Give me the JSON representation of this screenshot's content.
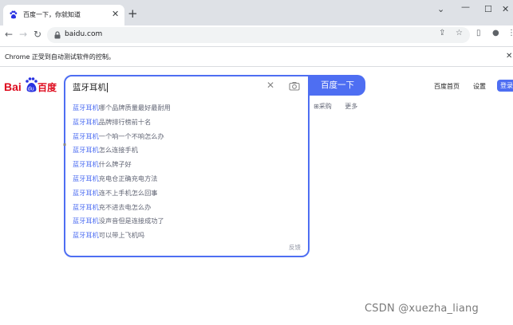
{
  "browser": {
    "tab_title": "百度一下，你就知道",
    "url": "baidu.com",
    "infobar_text": "Chrome 正受到自动测试软件的控制。"
  },
  "page": {
    "search_value": "蓝牙耳机",
    "search_button": "百度一下",
    "suggestions": [
      {
        "prefix": "蓝牙耳机",
        "rest": "哪个品牌质量最好最耐用"
      },
      {
        "prefix": "蓝牙耳机",
        "rest": "品牌排行榜前十名"
      },
      {
        "prefix": "蓝牙耳机",
        "rest": "一个响一个不响怎么办"
      },
      {
        "prefix": "蓝牙耳机",
        "rest": "怎么连接手机"
      },
      {
        "prefix": "蓝牙耳机",
        "rest": "什么牌子好"
      },
      {
        "prefix": "蓝牙耳机",
        "rest": "充电仓正确充电方法"
      },
      {
        "prefix": "蓝牙耳机",
        "rest": "连不上手机怎么回事"
      },
      {
        "prefix": "蓝牙耳机",
        "rest": "充不进去电怎么办"
      },
      {
        "prefix": "蓝牙耳机",
        "rest": "没声音但是连接成功了"
      },
      {
        "prefix": "蓝牙耳机",
        "rest": "可以带上飞机吗"
      }
    ],
    "feedback": "反馈",
    "tab_caigou": "采购",
    "tab_more": "更多",
    "top_links": {
      "home": "百度首页",
      "settings": "设置",
      "login": "登录"
    },
    "watermark": "CSDN @xuezha_liang"
  },
  "colors": {
    "accent": "#4e6ef2",
    "logo_red": "#de0b1e",
    "logo_blue": "#2932e1"
  }
}
